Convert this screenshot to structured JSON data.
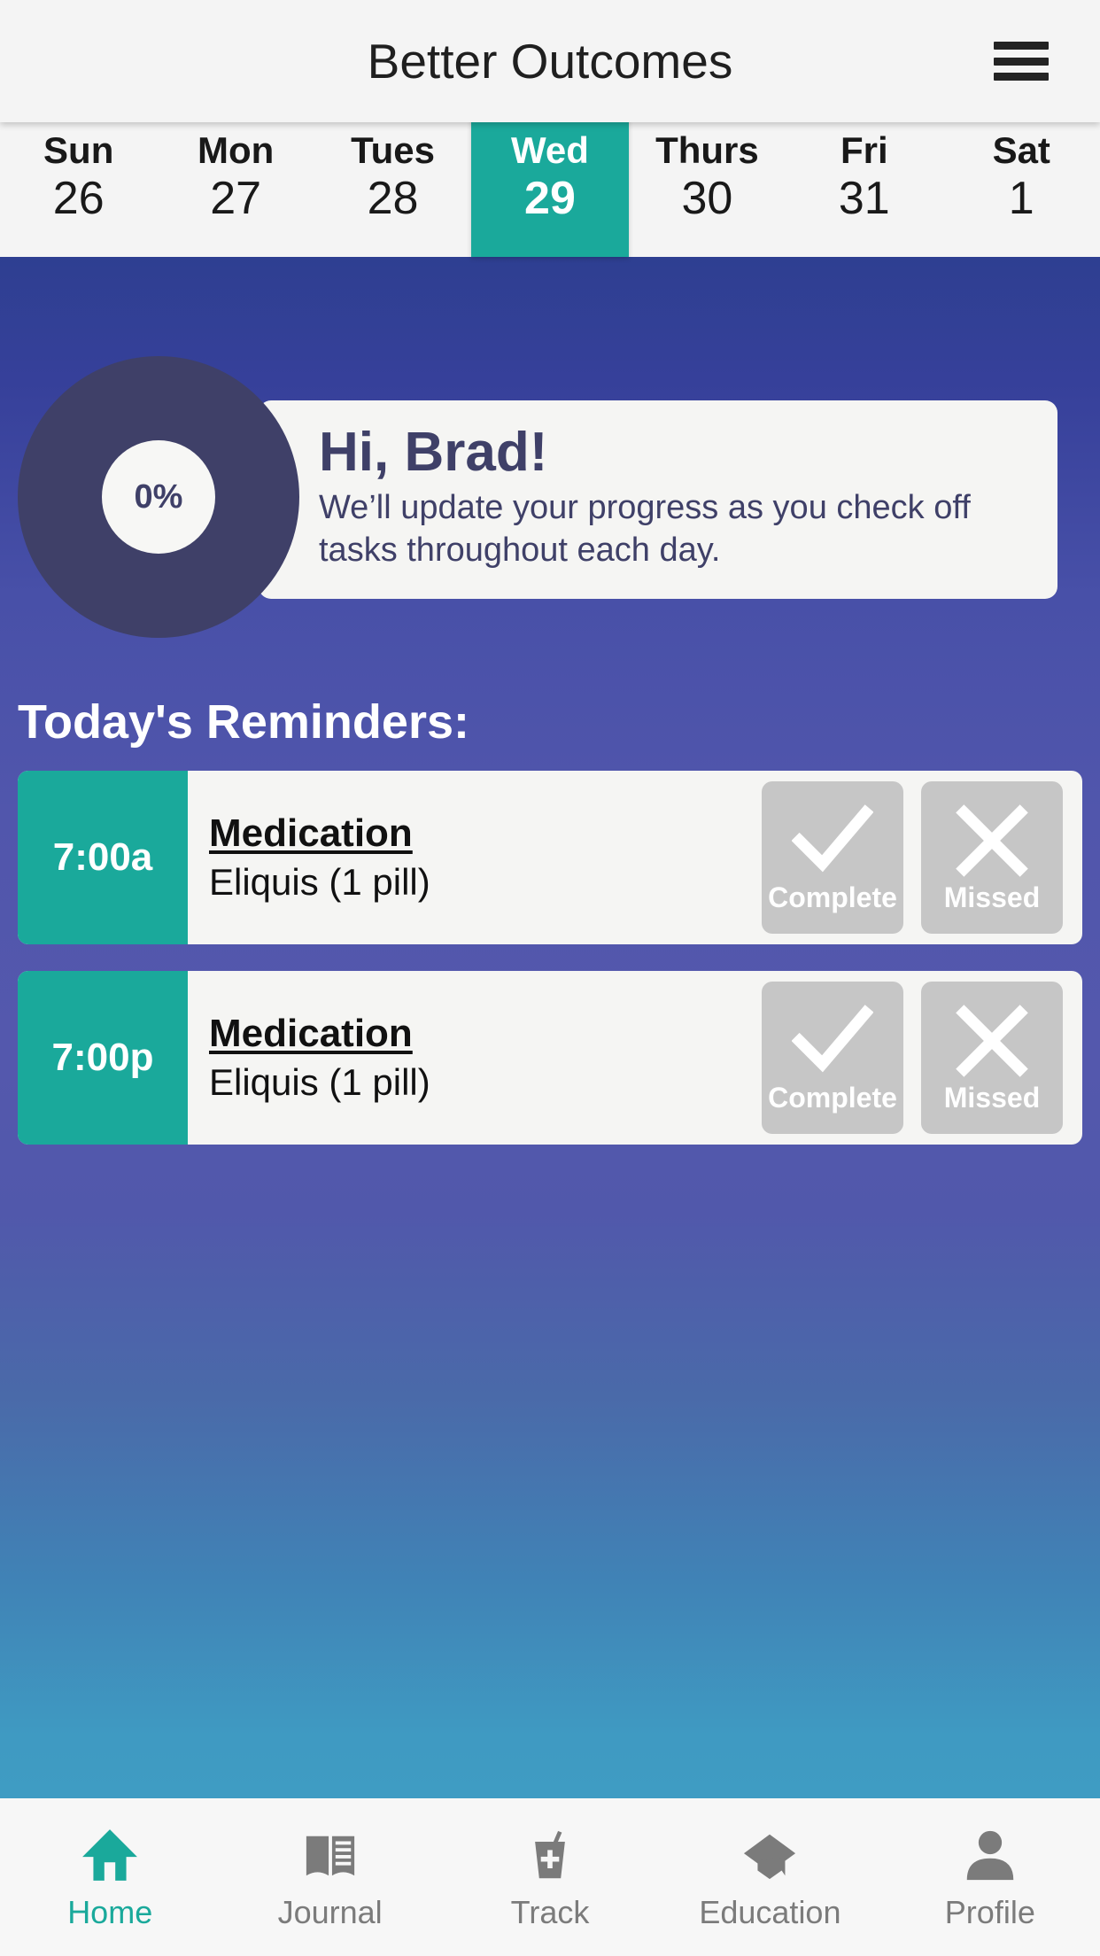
{
  "header": {
    "title": "Better Outcomes",
    "menu_icon": "hamburger-menu-icon"
  },
  "calendar": {
    "days": [
      {
        "dow": "Sun",
        "date": "26",
        "selected": false
      },
      {
        "dow": "Mon",
        "date": "27",
        "selected": false
      },
      {
        "dow": "Tues",
        "date": "28",
        "selected": false
      },
      {
        "dow": "Wed",
        "date": "29",
        "selected": true
      },
      {
        "dow": "Thurs",
        "date": "30",
        "selected": false
      },
      {
        "dow": "Fri",
        "date": "31",
        "selected": false
      },
      {
        "dow": "Sat",
        "date": "1",
        "selected": false
      }
    ]
  },
  "progress": {
    "percent_label": "0%",
    "percent_value": 0
  },
  "greeting": {
    "title": "Hi, Brad!",
    "message": "We’ll update your progress as you check off tasks throughout each day."
  },
  "reminders": {
    "heading": "Today's Reminders:",
    "items": [
      {
        "time": "7:00a",
        "type": "Medication",
        "detail": "Eliquis (1 pill)",
        "complete_label": "Complete",
        "missed_label": "Missed"
      },
      {
        "time": "7:00p",
        "type": "Medication",
        "detail": "Eliquis (1 pill)",
        "complete_label": "Complete",
        "missed_label": "Missed"
      }
    ]
  },
  "bottom_nav": {
    "items": [
      {
        "label": "Home",
        "icon": "home-icon",
        "active": true
      },
      {
        "label": "Journal",
        "icon": "book-icon",
        "active": false
      },
      {
        "label": "Track",
        "icon": "cup-plus-icon",
        "active": false
      },
      {
        "label": "Education",
        "icon": "graduation-cap-icon",
        "active": false
      },
      {
        "label": "Profile",
        "icon": "person-icon",
        "active": false
      }
    ]
  },
  "colors": {
    "accent_teal": "#1aa99b",
    "navy": "#3f4068",
    "card_bg": "#f5f5f3",
    "button_gray": "#c6c6c6",
    "nav_gray": "#7b7b7b"
  }
}
